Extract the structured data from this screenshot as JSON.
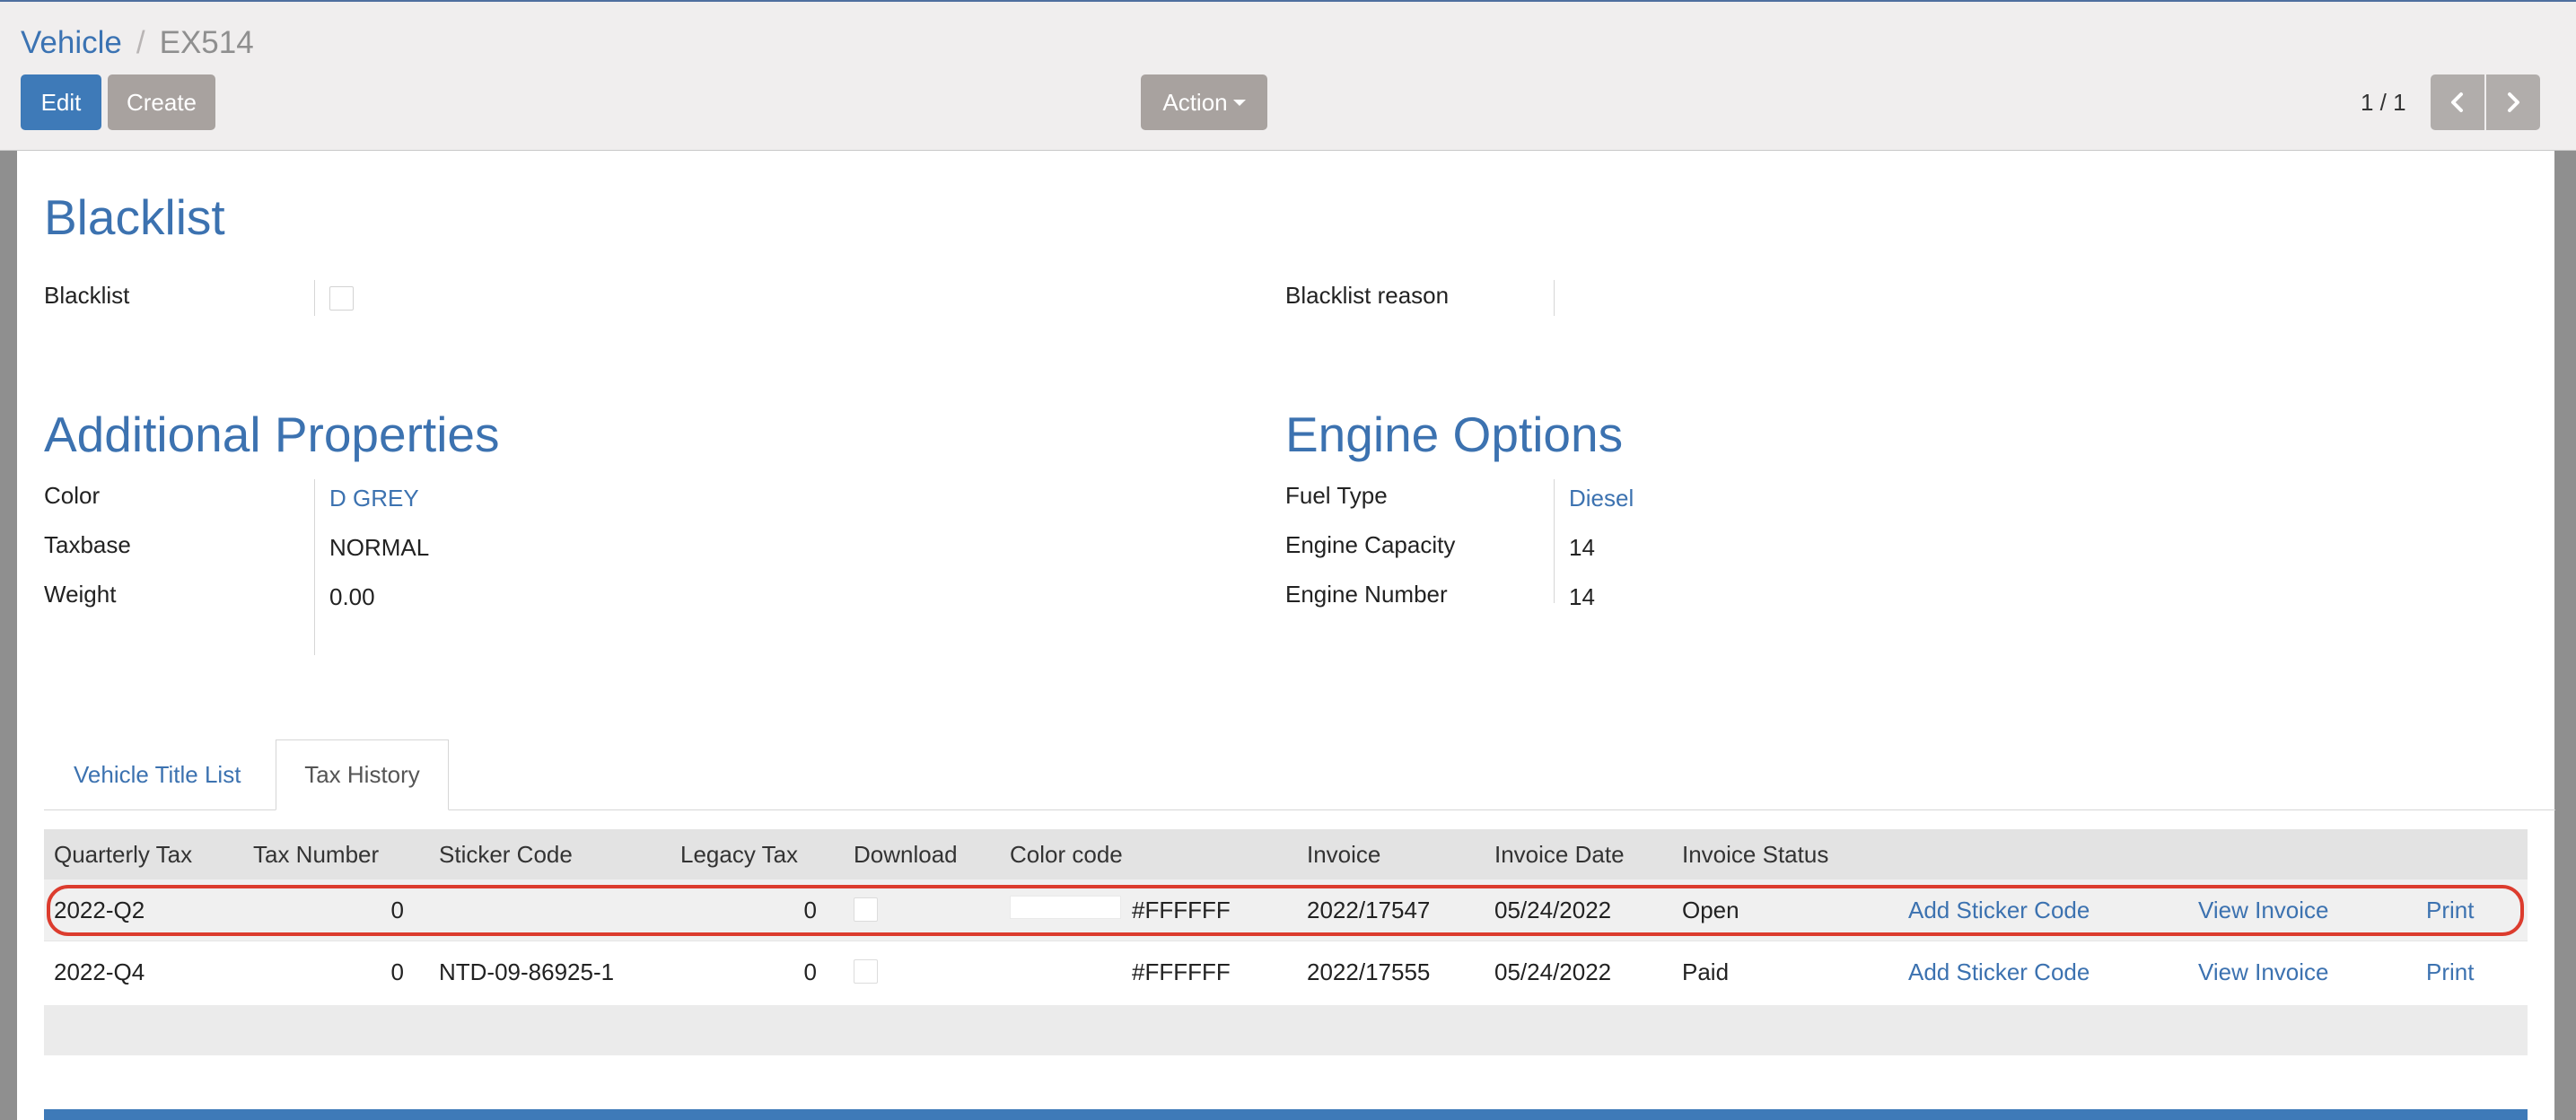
{
  "breadcrumb": {
    "parent": "Vehicle",
    "separator": "/",
    "current": "EX514"
  },
  "toolbar": {
    "edit_label": "Edit",
    "create_label": "Create",
    "action_label": "Action"
  },
  "pager": {
    "value": "1 / 1"
  },
  "blacklist_section": {
    "title": "Blacklist",
    "blacklist_label": "Blacklist",
    "blacklist_checked": false,
    "reason_label": "Blacklist reason",
    "reason_value": ""
  },
  "additional_properties": {
    "title": "Additional Properties",
    "color_label": "Color",
    "color_value": "D GREY",
    "taxbase_label": "Taxbase",
    "taxbase_value": "NORMAL",
    "weight_label": "Weight",
    "weight_value": "0.00"
  },
  "engine_options": {
    "title": "Engine Options",
    "fuel_type_label": "Fuel Type",
    "fuel_type_value": "Diesel",
    "engine_capacity_label": "Engine Capacity",
    "engine_capacity_value": "14",
    "engine_number_label": "Engine Number",
    "engine_number_value": "14"
  },
  "tabs": [
    {
      "label": "Vehicle Title List",
      "active": false
    },
    {
      "label": "Tax History",
      "active": true
    }
  ],
  "tax_table": {
    "columns": [
      "Quarterly Tax",
      "Tax Number",
      "Sticker Code",
      "Legacy Tax",
      "Download",
      "Color code",
      "Invoice",
      "Invoice Date",
      "Invoice Status"
    ],
    "rows": [
      {
        "quarterly_tax": "2022-Q2",
        "tax_number": "0",
        "sticker_code": "",
        "legacy_tax": "0",
        "download": false,
        "color_swatch": "#FFFFFF",
        "color_code": "#FFFFFF",
        "invoice": "2022/17547",
        "invoice_date": "05/24/2022",
        "invoice_status": "Open",
        "add_sticker": "Add Sticker Code",
        "view_invoice": "View Invoice",
        "print": "Print",
        "highlighted": true
      },
      {
        "quarterly_tax": "2022-Q4",
        "tax_number": "0",
        "sticker_code": "NTD-09-86925-1",
        "legacy_tax": "0",
        "download": false,
        "color_code": "#FFFFFF",
        "invoice": "2022/17555",
        "invoice_date": "05/24/2022",
        "invoice_status": "Paid",
        "add_sticker": "Add Sticker Code",
        "view_invoice": "View Invoice",
        "print": "Print",
        "highlighted": false
      }
    ]
  },
  "colors": {
    "accent": "#3C72B0",
    "primary_button": "#3E7AB8",
    "secondary_button": "#A8A29F",
    "highlight_ring": "#DC3C2E"
  }
}
